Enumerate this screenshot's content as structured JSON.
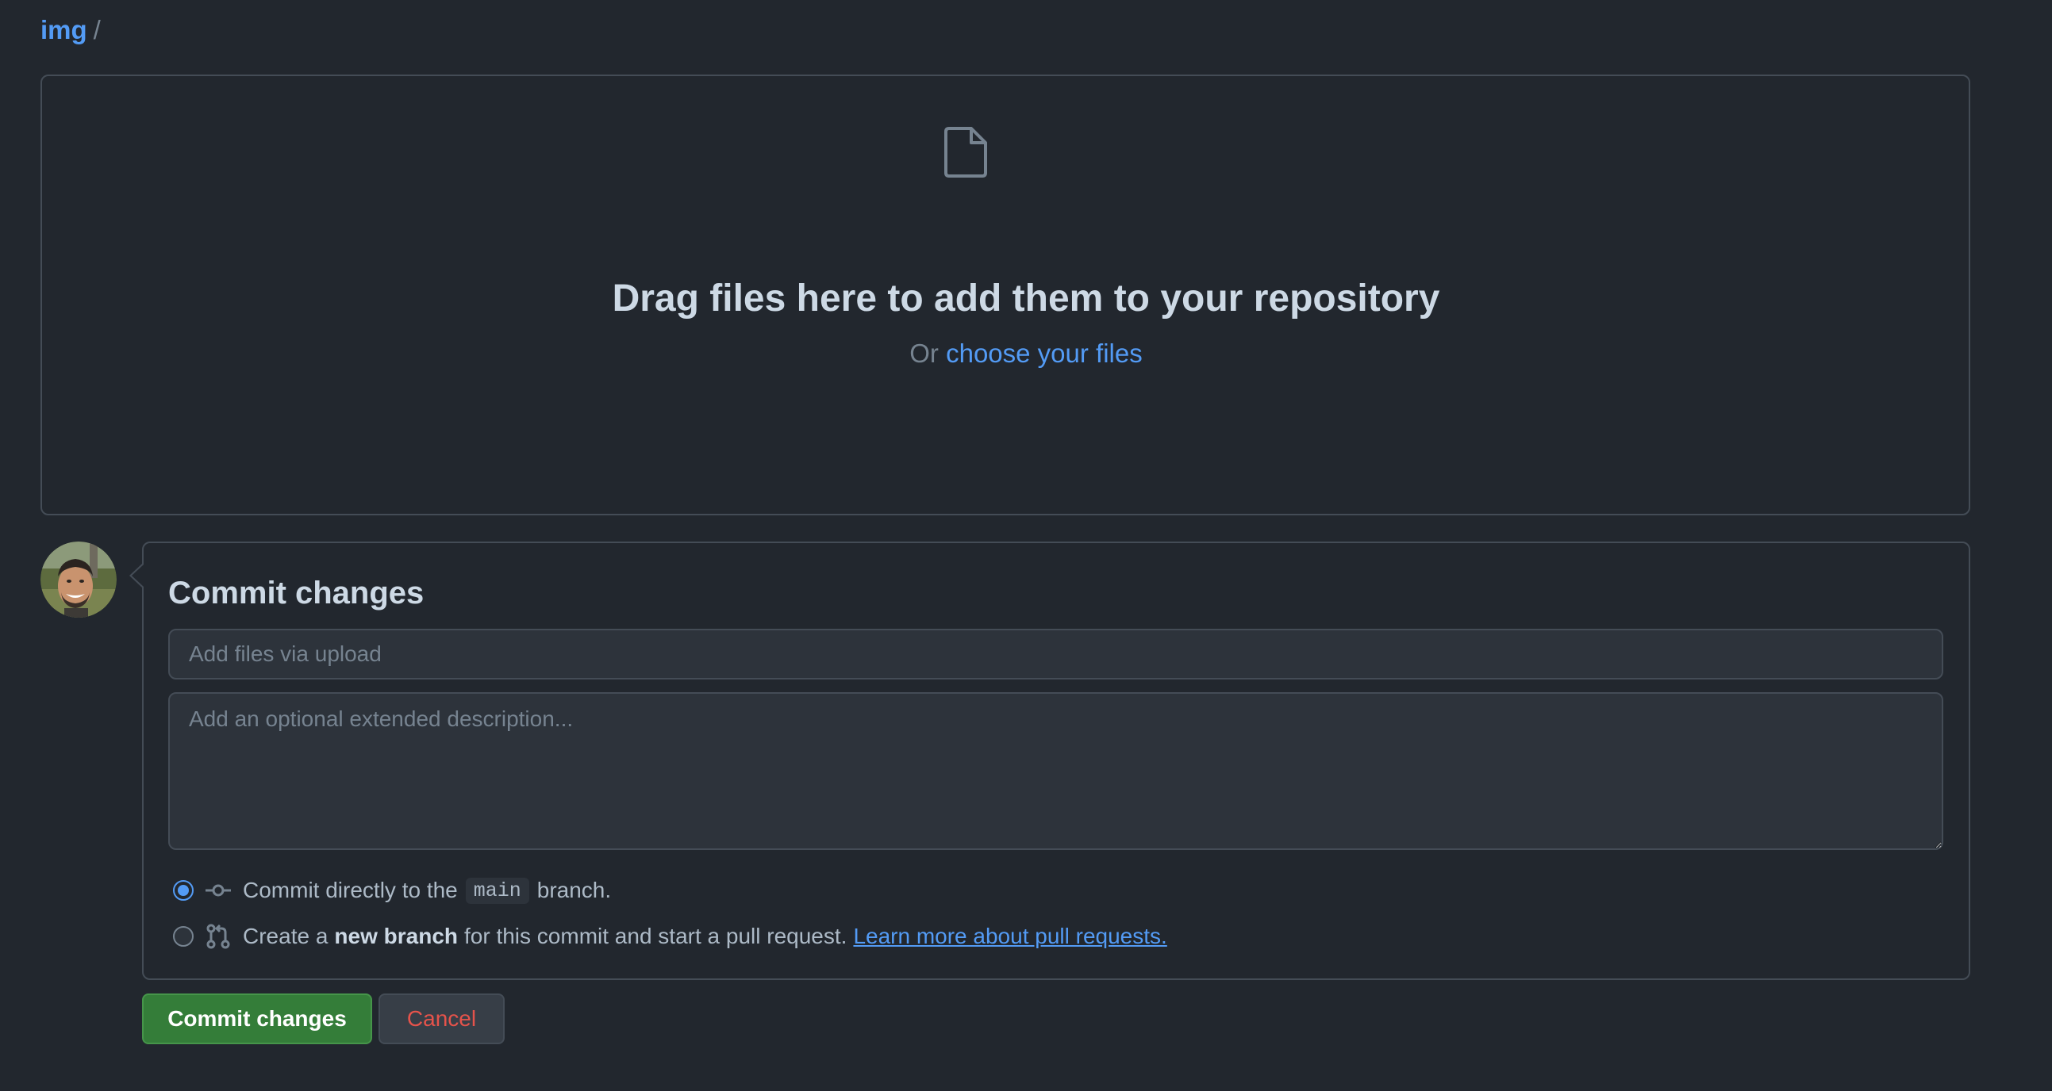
{
  "breadcrumb": {
    "repo": "img",
    "separator": "/"
  },
  "dropzone": {
    "icon": "file-icon",
    "title": "Drag files here to add them to your repository",
    "or_text": "Or",
    "choose_link": "choose your files"
  },
  "commit": {
    "avatar": "user-avatar",
    "title": "Commit changes",
    "summary_placeholder": "Add files via upload",
    "summary_value": "",
    "description_placeholder": "Add an optional extended description...",
    "description_value": "",
    "options": {
      "direct": {
        "selected": true,
        "icon": "git-commit-icon",
        "prefix": "Commit directly to the",
        "branch": "main",
        "suffix": "branch."
      },
      "new_branch": {
        "selected": false,
        "icon": "git-pull-request-icon",
        "prefix": "Create a",
        "bold": "new branch",
        "suffix": "for this commit and start a pull request.",
        "link": "Learn more about pull requests."
      }
    },
    "buttons": {
      "commit": "Commit changes",
      "cancel": "Cancel"
    }
  },
  "colors": {
    "background": "#22272e",
    "accent": "#539bf5",
    "commit_button": "#347d39",
    "cancel_text": "#e5534b"
  }
}
